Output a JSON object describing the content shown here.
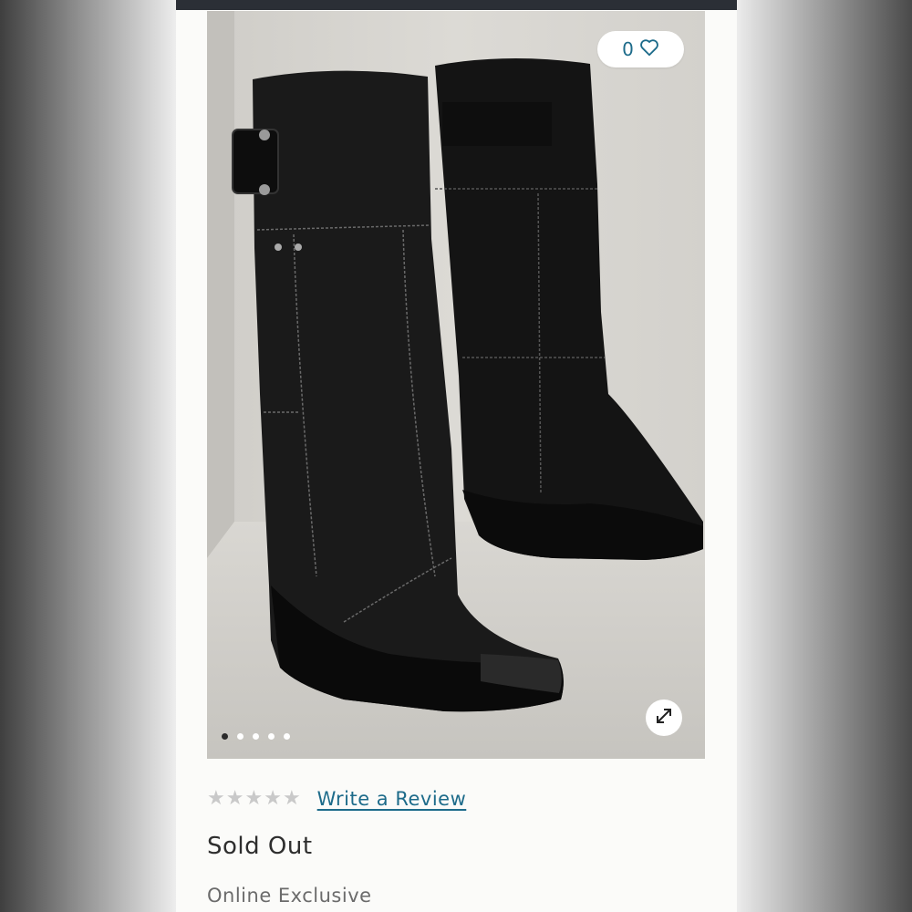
{
  "favorites": {
    "count": "0",
    "icon": "heart-outline-icon"
  },
  "gallery": {
    "image_count": 5,
    "active_index": 0,
    "zoom_icon": "expand-arrows-icon"
  },
  "product": {
    "rating_stars": 0,
    "review_link": "Write a Review",
    "status": "Sold Out",
    "availability": "Online Exclusive"
  },
  "colors": {
    "accent": "#1d6b8a",
    "header": "#2b2f36",
    "star_empty": "#c9c9c9"
  }
}
